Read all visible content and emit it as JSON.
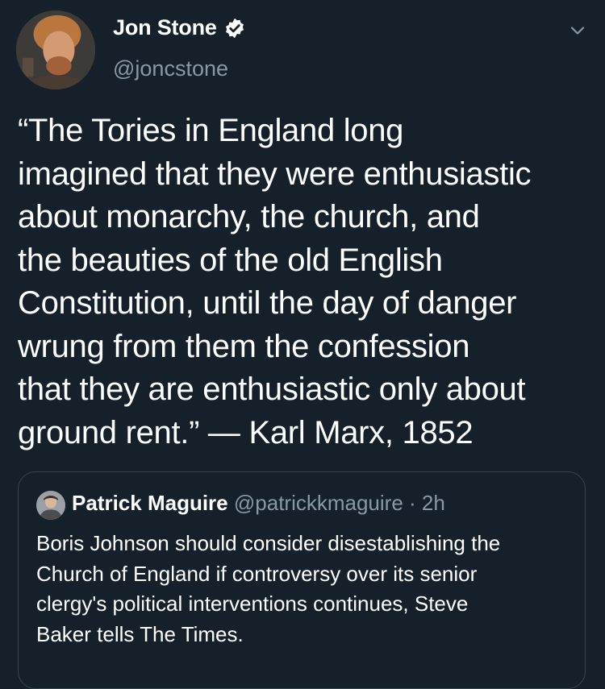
{
  "tweet": {
    "author": {
      "display_name": "Jon Stone",
      "handle": "@joncstone",
      "verified": true,
      "avatar_icon": "profile-photo"
    },
    "menu_icon": "chevron-down-icon",
    "text": "“The Tories in England long\nimagined that they were enthusiastic\nabout monarchy, the church, and\nthe beauties of the old English\nConstitution, until the day of danger\nwrung from them the confession\nthat they are enthusiastic only about\nground rent.” — Karl Marx, 1852"
  },
  "quoted_tweet": {
    "display_name": "Patrick Maguire",
    "handle": "@patrickkmaguire",
    "separator": "·",
    "time": "2h",
    "text": "Boris Johnson should consider disestablishing the\nChurch of England if controversy over its senior\nclergy's political interventions continues, Steve\nBaker tells The Times."
  },
  "colors": {
    "background": "#15202b",
    "primary_text": "#ffffff",
    "secondary_text": "#8899a6",
    "border": "#38444d",
    "verified_badge": "#ffffff"
  }
}
